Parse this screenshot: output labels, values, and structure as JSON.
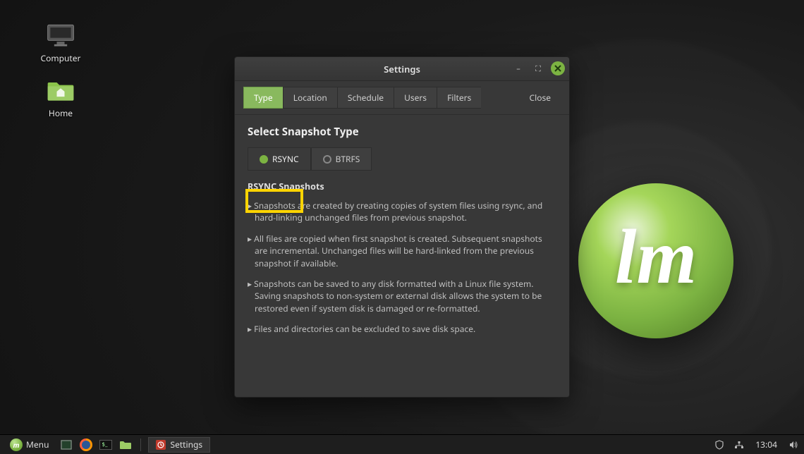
{
  "desktop": {
    "computer_label": "Computer",
    "home_label": "Home"
  },
  "window": {
    "title": "Settings",
    "tabs": {
      "type": "Type",
      "location": "Location",
      "schedule": "Schedule",
      "users": "Users",
      "filters": "Filters"
    },
    "close_label": "Close",
    "section_heading": "Select Snapshot Type",
    "snapshot_types": {
      "rsync": "RSYNC",
      "btrfs": "BTRFS"
    },
    "rsync_heading": "RSYNC Snapshots",
    "bullets": {
      "b1": "Snapshots are created by creating copies of system files using rsync, and hard-linking unchanged files from previous snapshot.",
      "b2": "All files are copied when first snapshot is created. Subsequent snapshots are incremental. Unchanged files will be hard-linked from the previous snapshot if available.",
      "b3": "Snapshots can be saved to any disk formatted with a Linux file system. Saving snapshots to non-system or external disk allows the system to be restored even if system disk is damaged or re-formatted.",
      "b4": "Files and directories can be excluded to save disk space."
    }
  },
  "taskbar": {
    "menu": "Menu",
    "app_label": "Settings",
    "clock": "13:04"
  }
}
